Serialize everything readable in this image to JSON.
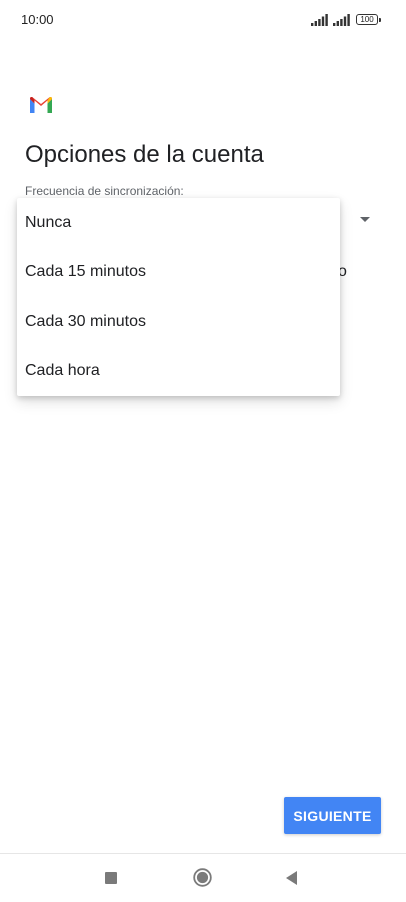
{
  "status_bar": {
    "time": "10:00",
    "battery": "100",
    "icons": [
      "signal-icon",
      "signal-icon",
      "battery-icon"
    ]
  },
  "app": {
    "logo": "gmail-logo",
    "title": "Opciones de la cuenta"
  },
  "sync_field": {
    "label": "Frecuencia de sincronización:",
    "hidden_text_fragment": "o"
  },
  "dropdown": {
    "options": [
      "Nunca",
      "Cada 15 minutos",
      "Cada 30 minutos",
      "Cada hora"
    ]
  },
  "actions": {
    "next_label": "SIGUIENTE"
  },
  "colors": {
    "primary_button": "#4285f4",
    "gmail_red": "#ea4335",
    "gmail_blue": "#4285f4",
    "gmail_green": "#34a853",
    "gmail_yellow": "#fbbc04"
  },
  "nav_bar": {
    "icons": [
      "recents-icon",
      "home-icon",
      "back-icon"
    ]
  }
}
